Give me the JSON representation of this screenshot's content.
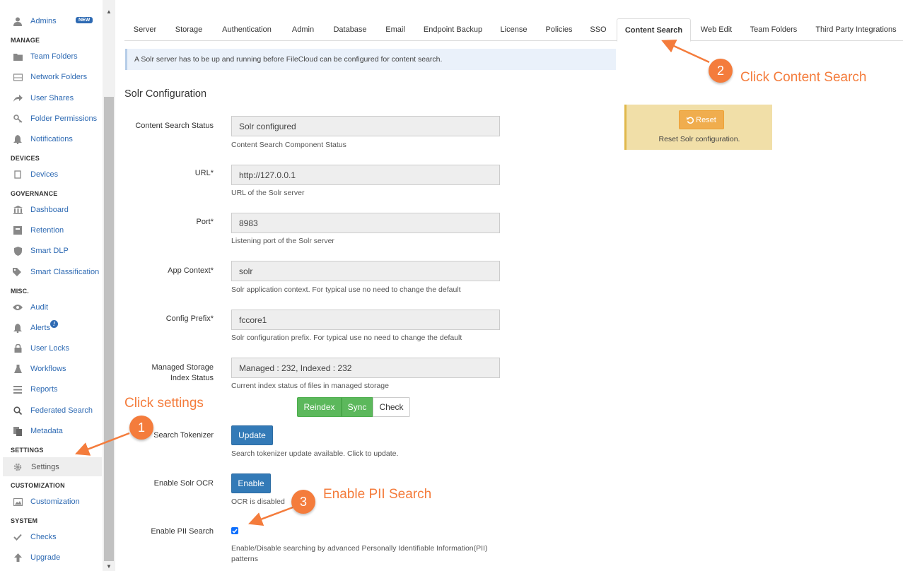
{
  "sidebar": {
    "top_item": {
      "label": "Admins",
      "badge": "NEW",
      "icon": "user-icon"
    },
    "sections": [
      {
        "title": "MANAGE"
      },
      {
        "title": "DEVICES"
      },
      {
        "title": "GOVERNANCE"
      },
      {
        "title": "MISC."
      },
      {
        "title": "SETTINGS"
      },
      {
        "title": "CUSTOMIZATION"
      },
      {
        "title": "SYSTEM"
      }
    ],
    "items": [
      {
        "label": "Team Folders",
        "icon": "folder-icon"
      },
      {
        "label": "Network Folders",
        "icon": "network-folder-icon"
      },
      {
        "label": "User Shares",
        "icon": "share-icon"
      },
      {
        "label": "Folder Permissions",
        "icon": "key-icon"
      },
      {
        "label": "Notifications",
        "icon": "bell-icon"
      },
      {
        "label": "Devices",
        "icon": "device-icon"
      },
      {
        "label": "Dashboard",
        "icon": "bank-icon"
      },
      {
        "label": "Retention",
        "icon": "retention-icon"
      },
      {
        "label": "Smart DLP",
        "icon": "shield-icon"
      },
      {
        "label": "Smart Classification",
        "icon": "tags-icon"
      },
      {
        "label": "Audit",
        "icon": "eye-icon"
      },
      {
        "label": "Alerts",
        "icon": "bell-icon",
        "badge": "!"
      },
      {
        "label": "User Locks",
        "icon": "lock-icon"
      },
      {
        "label": "Workflows",
        "icon": "flask-icon"
      },
      {
        "label": "Reports",
        "icon": "list-icon"
      },
      {
        "label": "Federated Search",
        "icon": "search-icon"
      },
      {
        "label": "Metadata",
        "icon": "copy-icon"
      },
      {
        "label": "Settings",
        "icon": "gear-icon"
      },
      {
        "label": "Customization",
        "icon": "image-icon"
      },
      {
        "label": "Checks",
        "icon": "check-icon"
      },
      {
        "label": "Upgrade",
        "icon": "arrow-up-icon"
      }
    ]
  },
  "tabs": [
    "Server",
    "Storage",
    "Authentication",
    "Admin",
    "Database",
    "Email",
    "Endpoint Backup",
    "License",
    "Policies",
    "SSO",
    "Content Search",
    "Web Edit",
    "Team Folders",
    "Third Party Integrations"
  ],
  "active_tab": "Content Search",
  "info": "A Solr server has to be up and running before FileCloud can be configured for content search.",
  "section_title": "Solr Configuration",
  "fields": {
    "status": {
      "label": "Content Search Status",
      "value": "Solr configured",
      "help": "Content Search Component Status"
    },
    "url": {
      "label": "URL*",
      "value": "http://127.0.0.1",
      "help": "URL of the Solr server"
    },
    "port": {
      "label": "Port*",
      "value": "8983",
      "help": "Listening port of the Solr server"
    },
    "context": {
      "label": "App Context*",
      "value": "solr",
      "help": "Solr application context. For typical use no need to change the default"
    },
    "prefix": {
      "label": "Config Prefix*",
      "value": "fccore1",
      "help": "Solr configuration prefix. For typical use no need to change the default"
    },
    "index": {
      "label_1": "Managed Storage",
      "label_2": "Index Status",
      "value": "Managed : 232, Indexed : 232",
      "help": "Current index status of files in managed storage"
    }
  },
  "index_buttons": {
    "reindex": "Reindex",
    "sync": "Sync",
    "check": "Check"
  },
  "tokenizer": {
    "label": "Search Tokenizer",
    "button": "Update",
    "help": "Search tokenizer update available. Click to update."
  },
  "ocr": {
    "label": "Enable Solr OCR",
    "button": "Enable",
    "help": "OCR is disabled"
  },
  "pii": {
    "label": "Enable PII Search",
    "checked": true,
    "help_1": "Enable/Disable searching by advanced Personally Identifiable Information(PII)",
    "help_2": "patterns"
  },
  "reset": {
    "button": "Reset",
    "desc": "Reset Solr configuration."
  },
  "annotations": {
    "a1_text": "Click settings",
    "a1_num": "1",
    "a2_text": "Click Content Search",
    "a2_num": "2",
    "a3_text": "Enable PII Search",
    "a3_num": "3"
  },
  "colors": {
    "accent": "#f47c3c",
    "link": "#2e6ab3",
    "primary": "#337ab7",
    "success": "#5cb85c",
    "warning": "#f0ad4e"
  }
}
